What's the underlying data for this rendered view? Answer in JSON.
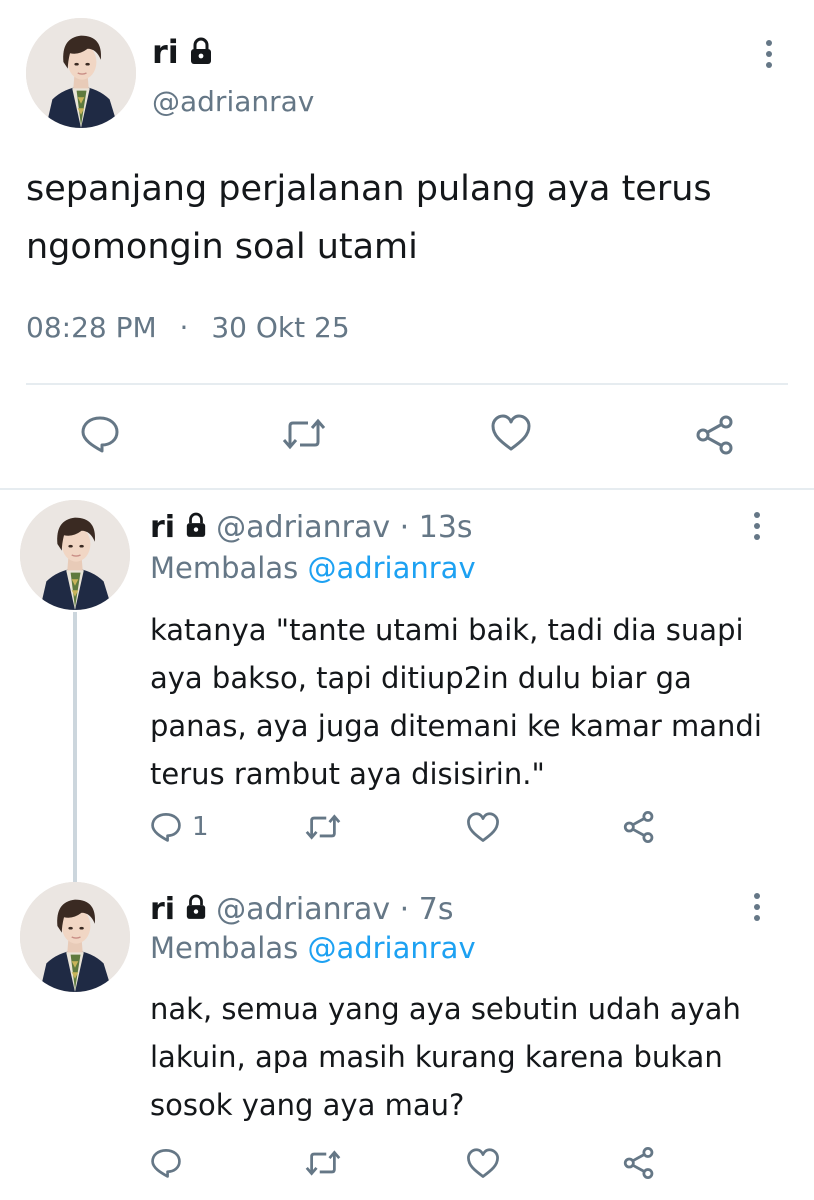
{
  "main_tweet": {
    "display_name": "ri",
    "handle": "@adrianrav",
    "text_line1": "sepanjang perjalanan pulang aya terus",
    "text_line2": "ngomongin soal utami",
    "time": "08:28 PM",
    "separator": "·",
    "date": "30 Okt 25"
  },
  "replies": [
    {
      "display_name": "ri",
      "handle_time": "@adrianrav · 13s",
      "replying_prefix": "Membalas",
      "replying_to": "@adrianrav",
      "lines": [
        "katanya \"tante utami baik, tadi dia suapi",
        "aya bakso, tapi ditiup2in dulu biar ga",
        "panas, aya juga ditemani ke kamar mandi",
        "terus rambut aya disisirin.\""
      ],
      "reply_count": "1"
    },
    {
      "display_name": "ri",
      "handle_time": "@adrianrav · 7s",
      "replying_prefix": "Membalas",
      "replying_to": "@adrianrav",
      "lines": [
        "nak, semua yang aya sebutin udah ayah",
        "lakuin, apa masih kurang karena bukan",
        "sosok yang aya mau?"
      ],
      "reply_count": ""
    }
  ],
  "icons": {
    "reply": "reply-icon",
    "retweet": "retweet-icon",
    "like": "heart-icon",
    "share": "share-icon",
    "more": "more-options-icon",
    "lock": "lock-icon"
  },
  "colors": {
    "text": "#14171a",
    "muted": "#657786",
    "link": "#1da1f2",
    "divider": "#e6ecf0"
  }
}
